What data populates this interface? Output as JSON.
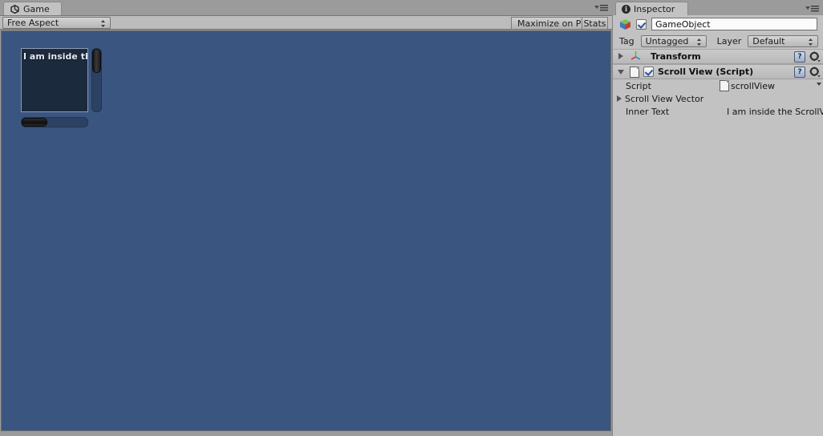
{
  "game_panel": {
    "tab": {
      "label": "Game",
      "icon": "unity-icon"
    },
    "menu_icon": "panel-menu-icon",
    "toolbar": {
      "aspect": {
        "value": "Free Aspect",
        "icon": "updown-arrows-icon"
      },
      "maximize_on_play": "Maximize on Play",
      "stats": "Stats"
    },
    "view": {
      "background_color": "#3a5580",
      "scrollview": {
        "content_background": "#1c2a3e",
        "inner_text": "I am inside the",
        "vertical_scrollbar": {
          "position": "top"
        },
        "horizontal_scrollbar": {
          "position": "left"
        }
      }
    }
  },
  "inspector": {
    "tab": {
      "label": "Inspector",
      "icon": "info-icon"
    },
    "menu_icon": "panel-menu-icon",
    "gameobject": {
      "icon": "cube-icon",
      "enabled": true,
      "name": "GameObject",
      "tag_label": "Tag",
      "tag_value": "Untagged",
      "layer_label": "Layer",
      "layer_value": "Default"
    },
    "components": [
      {
        "title": "Transform",
        "expanded": false,
        "icon": "transform-axis-icon",
        "has_checkbox": false,
        "help_icon": "help-icon",
        "gear_icon": "gear-icon"
      },
      {
        "title": "Scroll View (Script)",
        "expanded": true,
        "icon": "script-icon",
        "has_checkbox": true,
        "enabled": true,
        "help_icon": "help-icon",
        "gear_icon": "gear-icon",
        "properties": [
          {
            "label": "Script",
            "type": "object",
            "value": "scrollView",
            "icon": "script-icon"
          },
          {
            "label": "Scroll View Vector",
            "type": "foldout",
            "expanded": false
          },
          {
            "label": "Inner Text",
            "type": "text",
            "value": "I am inside the ScrollV"
          }
        ]
      }
    ]
  }
}
